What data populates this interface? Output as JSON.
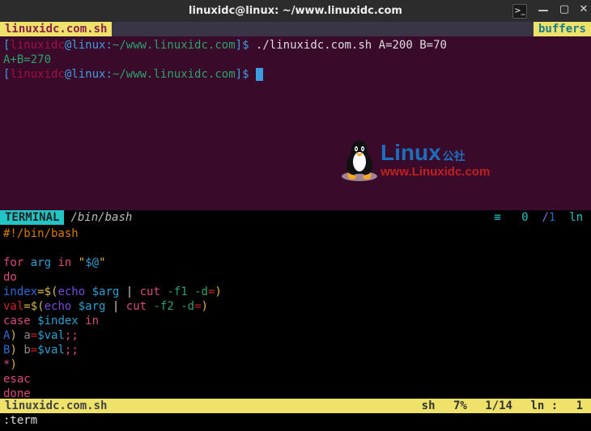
{
  "window": {
    "title": "linuxidc@linux: ~/www.linuxidc.com",
    "icon": ">_",
    "min": "—",
    "max": "▢",
    "close": "✕"
  },
  "tabstrip": {
    "tab": "linuxidc.com.sh",
    "buffers": "buffers"
  },
  "term": {
    "user": "linuxidc",
    "at": "@",
    "host": "linux",
    "path": "~/www.linuxidc.com",
    "bracket_open": "[",
    "bracket_close": "]",
    "dollar": "$",
    "tilde": ":",
    "cmd1": " ./linuxidc.com.sh A=200 B=70",
    "result": "A+B=270"
  },
  "logo": {
    "text1": "Linux",
    "sub": "公社",
    "text2": "www.Linuxidc.com"
  },
  "divider": {
    "label": "TERMINAL",
    "shell": "/bin/bash",
    "hamburger": "≡",
    "n0": "0",
    "slash": "/",
    "n1": "1",
    "ln": "ln"
  },
  "script": {
    "l1": "#!/bin/bash",
    "l2": "",
    "l3": {
      "for": "for",
      "arg": "arg",
      "in": "in",
      "q": "\"",
      "str": "$@"
    },
    "l4": "do",
    "l5": {
      "index": "index",
      "eq": "=$(",
      "echo": "echo",
      "arg": "$arg",
      "pipe": " | ",
      "cut": "cut",
      "flags": " -f1 -d",
      "eqo": "=",
      "cp": ")"
    },
    "l6": {
      "val": "val",
      "eq": "=$(",
      "echo": "echo",
      "arg": "$arg",
      "pipe": " | ",
      "cut": "cut",
      "flags": " -f2 -d",
      "eqo": "=",
      "cp": ")"
    },
    "l7": {
      "case": "case",
      "var": "$index",
      "in": "in"
    },
    "l8": {
      "A": "A",
      "cp": ")",
      "sp": " ",
      "a": "a",
      "eq": "=",
      "val": "$val",
      "end": ";;"
    },
    "l9": {
      "B": "B",
      "cp": ")",
      "sp": " ",
      "b": "b",
      "eq": "=",
      "val": "$val",
      "end": ";;"
    },
    "l10": {
      "star": "*",
      "cp": ")"
    },
    "l11": "esac",
    "l12": "done"
  },
  "status": {
    "fname": "linuxidc.com.sh",
    "sh": "sh",
    "pct": "7%",
    "pos": "1/14",
    "ln": "ln :",
    "col": "1"
  },
  "cmdline": ":term"
}
